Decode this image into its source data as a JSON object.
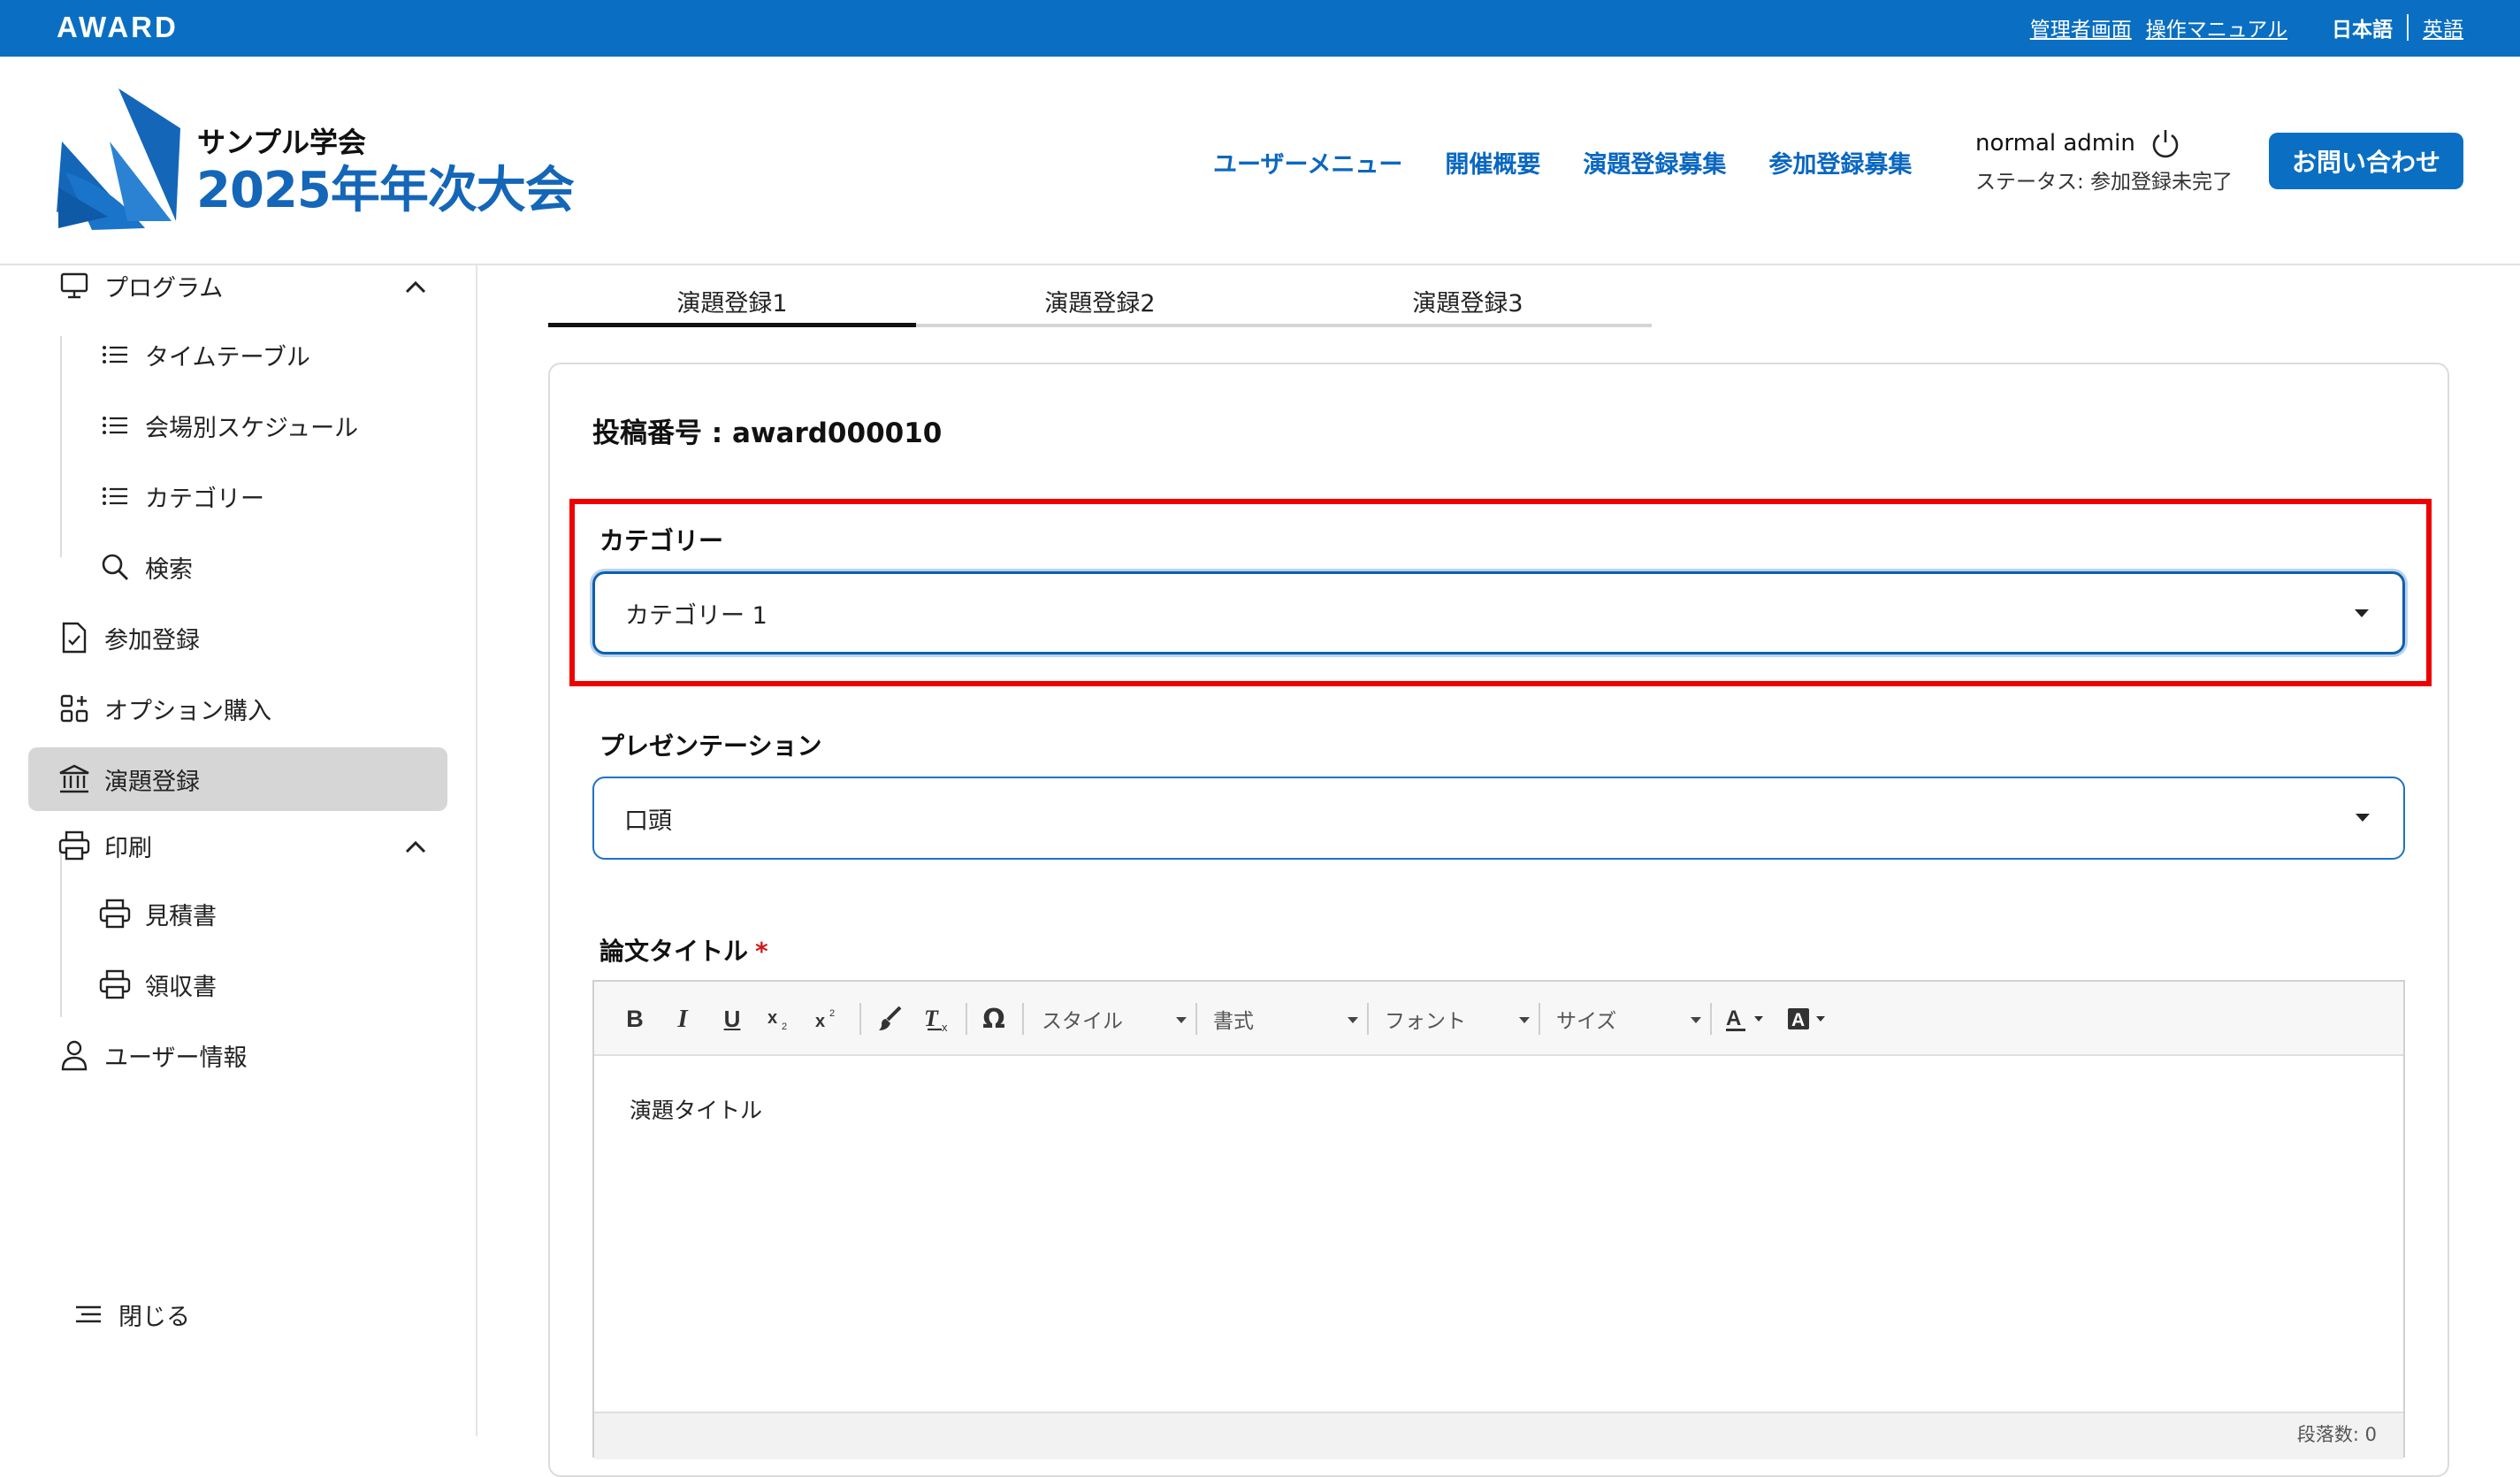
{
  "topbar": {
    "brand": "AWARD",
    "admin_link": "管理者画面",
    "manual_link": "操作マニュアル",
    "lang_current": "日本語",
    "lang_other": "英語"
  },
  "header": {
    "society": "サンプル学会",
    "conference": "2025年年次大会",
    "nav": [
      "ユーザーメニュー",
      "開催概要",
      "演題登録募集",
      "参加登録募集"
    ],
    "user_name": "normal admin",
    "user_status": "ステータス: 参加登録未完了",
    "contact_button": "お問い合わせ",
    "brand_color": "#0a6fc2"
  },
  "sidebar": {
    "program": "プログラム",
    "timetable": "タイムテーブル",
    "venue_schedule": "会場別スケジュール",
    "category": "カテゴリー",
    "search": "検索",
    "registration": "参加登録",
    "option_purchase": "オプション購入",
    "abstract_registration": "演題登録",
    "print": "印刷",
    "estimate": "見積書",
    "receipt": "領収書",
    "user_info": "ユーザー情報",
    "close": "閉じる"
  },
  "tabs": [
    "演題登録1",
    "演題登録2",
    "演題登録3"
  ],
  "form": {
    "post_number": "投稿番号 : award000010",
    "category_label": "カテゴリー",
    "category_value": "カテゴリー 1",
    "presentation_label": "プレゼンテーション",
    "presentation_value": "口頭",
    "title_label": "論文タイトル",
    "required_mark": "*",
    "editor_content": "演題タイトル",
    "editor_status": "段落数: 0"
  },
  "toolbar": {
    "omega": "Ω",
    "style": "スタイル",
    "format": "書式",
    "font": "フォント",
    "size": "サイズ"
  }
}
